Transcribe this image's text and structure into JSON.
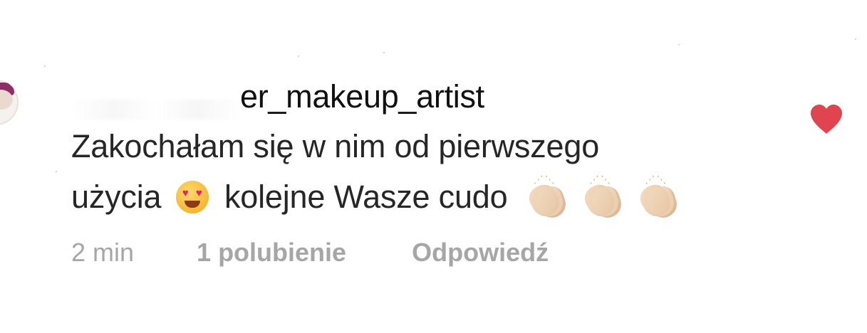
{
  "comment": {
    "username_visible": "er_makeup_artist",
    "text_line1": "Zakochałam się w nim od pierwszego",
    "text_line2_before_emoji": "użycia",
    "text_line2_after_emoji": "kolejne Wasze cudo",
    "emojis": [
      "heart-eyes-emoji",
      "clapping-hands-emoji",
      "clapping-hands-emoji",
      "clapping-hands-emoji"
    ],
    "like_state": "liked"
  },
  "meta": {
    "time": "2 min",
    "likes": "1 polubienie",
    "reply": "Odpowiedź"
  },
  "colors": {
    "heart": "#e0454f",
    "meta_text": "#a6a6a6",
    "text": "#262626"
  }
}
